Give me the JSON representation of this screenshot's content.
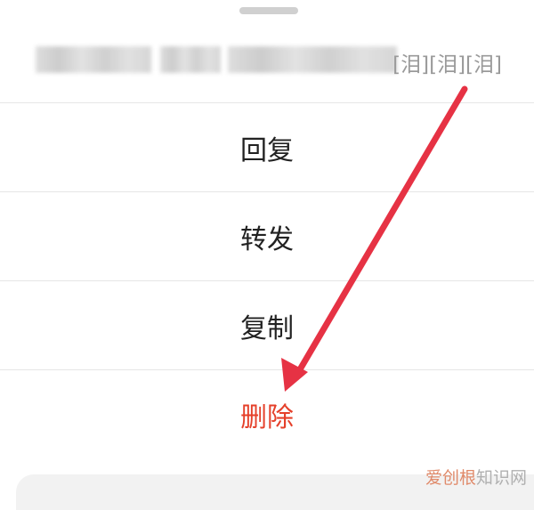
{
  "sheet": {
    "preview_emoji_text": "[泪][泪][泪]"
  },
  "menu": {
    "items": [
      {
        "label": "回复"
      },
      {
        "label": "转发"
      },
      {
        "label": "复制"
      },
      {
        "label": "删除",
        "color": "#e5402a"
      }
    ]
  },
  "annotation": {
    "arrow_color": "#e63244"
  },
  "watermark": {
    "part1": "爱创根",
    "part2": "知识网"
  }
}
